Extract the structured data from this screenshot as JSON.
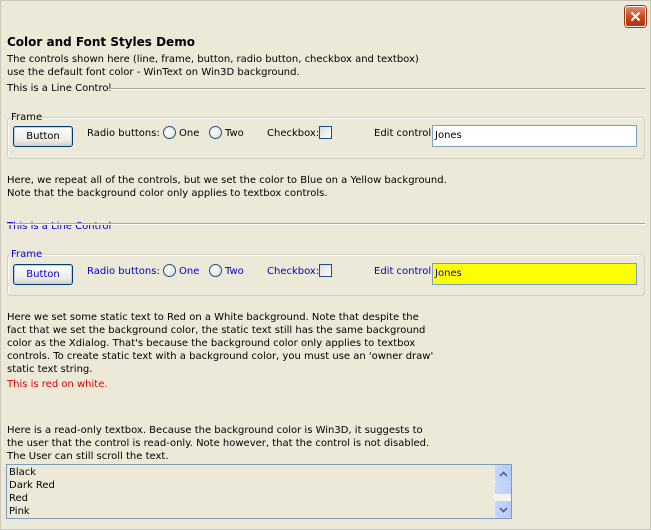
{
  "window": {
    "close_label": "✕"
  },
  "header": {
    "title": "Color and Font Styles Demo",
    "desc_line1": "The controls shown here (line, frame, button, radio button, checkbox and textbox)",
    "desc_line2": "use the default font color - WinText on Win3D background.",
    "line_control_label": "This is a Line Control"
  },
  "section1": {
    "frame_label": "Frame",
    "button_label": "Button",
    "radio_label": "Radio buttons:",
    "radio_one": "One",
    "radio_two": "Two",
    "checkbox_label": "Checkbox:",
    "edit_label": "Edit control:",
    "edit_value": "Jones"
  },
  "para2": {
    "line1": "Here, we repeat all of the controls, but we set the color to Blue on a Yellow background.",
    "line2": "Note that the background color only applies to textbox controls."
  },
  "section2": {
    "line_control_label": "This is a Line Control",
    "frame_label": "Frame",
    "button_label": "Button",
    "radio_label": "Radio buttons:",
    "radio_one": "One",
    "radio_two": "Two",
    "checkbox_label": "Checkbox:",
    "edit_label": "Edit control:",
    "edit_value": "Jones",
    "accent_color": "#0000cc",
    "edit_bg_color": "#ffff00"
  },
  "para3": {
    "line1": "Here we set some static text to Red on a White background. Note that despite the",
    "line2": "fact that we set the background color, the static text still has the same background",
    "line3": "color as the Xdialog. That's because the background color only applies to textbox",
    "line4": "controls. To create static text with a background color, you must use an 'owner draw'",
    "line5": "static text string.",
    "red_text": "This is red on white.",
    "red_color": "#e00000"
  },
  "para4": {
    "line1": "Here is a read-only textbox. Because the background color is Win3D, it suggests to",
    "line2": "the user that the control is read-only. Note however, that the control is not disabled.",
    "line3": "The User can still scroll the text."
  },
  "listbox": {
    "items": [
      "Black",
      "Dark Red",
      "Red",
      "Pink"
    ]
  }
}
